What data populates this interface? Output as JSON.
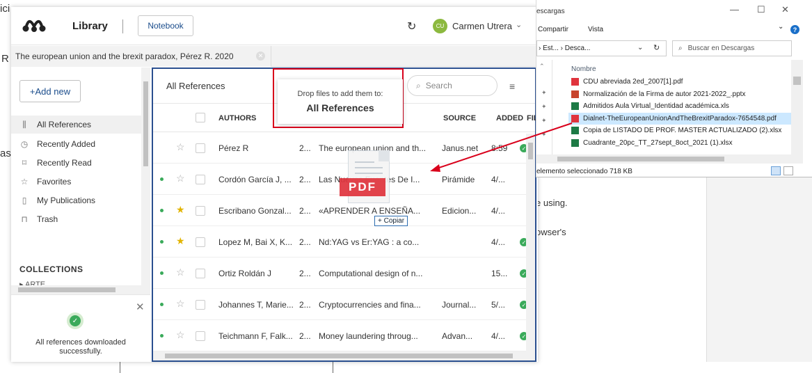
{
  "background": {
    "edge_text_top": "ici",
    "edge_text_r": "R",
    "edge_text_as": "as",
    "frag_using": "e using.",
    "frag_browser": "owser's"
  },
  "mendeley": {
    "header": {
      "library_title": "Library",
      "notebook_label": "Notebook",
      "avatar_initials": "CU",
      "user_name": "Carmen Utrera"
    },
    "tab": {
      "label": "The european union and the brexit paradox, Pérez R. 2020"
    },
    "sidebar": {
      "add_new_label": "+Add new",
      "items": [
        {
          "label": "All References",
          "icon": "library-icon",
          "glyph": "⫼"
        },
        {
          "label": "Recently Added",
          "icon": "clock-icon",
          "glyph": "◷"
        },
        {
          "label": "Recently Read",
          "icon": "bookmark-icon",
          "glyph": "⌑"
        },
        {
          "label": "Favorites",
          "icon": "star-icon",
          "glyph": "☆"
        },
        {
          "label": "My Publications",
          "icon": "document-icon",
          "glyph": "▯"
        },
        {
          "label": "Trash",
          "icon": "trash-icon",
          "glyph": "🗑"
        }
      ],
      "collections_heading": "COLLECTIONS",
      "collection_first": "ARTE"
    },
    "toast": {
      "message": "All references downloaded successfully."
    },
    "main": {
      "title": "All References",
      "search_placeholder": "Search",
      "columns": {
        "authors": "AUTHORS",
        "source": "SOURCE",
        "added": "ADDED",
        "file": "FIL"
      },
      "rows": [
        {
          "unread": false,
          "favorite": false,
          "author": "Pérez R",
          "year": "2...",
          "title": "The european union and th...",
          "source": "Janus.net",
          "added": "8:59",
          "downloaded": true
        },
        {
          "unread": true,
          "favorite": false,
          "author": "Cordón García J, ...",
          "year": "2...",
          "title": "Las Nuevas Fuentes De I...",
          "source": "Pirámide",
          "added": "4/...",
          "downloaded": false
        },
        {
          "unread": true,
          "favorite": true,
          "author": "Escribano Gonzal...",
          "year": "2...",
          "title": "«APRENDER A ENSEÑA...",
          "source": "Edicion...",
          "added": "4/...",
          "downloaded": false
        },
        {
          "unread": true,
          "favorite": true,
          "author": "Lopez M, Bai X, K...",
          "year": "2...",
          "title": "Nd:YAG vs Er:YAG : a co...",
          "source": "",
          "added": "4/...",
          "downloaded": true
        },
        {
          "unread": true,
          "favorite": false,
          "author": "Ortiz Roldán J",
          "year": "2...",
          "title": "Computational design of n...",
          "source": "",
          "added": "15...",
          "downloaded": true
        },
        {
          "unread": true,
          "favorite": false,
          "author": "Johannes T, Marie...",
          "year": "2...",
          "title": "Cryptocurrencies and fina...",
          "source": "Journal...",
          "added": "5/...",
          "downloaded": true
        },
        {
          "unread": true,
          "favorite": false,
          "author": "Teichmann F, Falk...",
          "year": "2...",
          "title": "Money laundering throug...",
          "source": "Advan...",
          "added": "4/...",
          "downloaded": true
        }
      ]
    },
    "drop_overlay": {
      "subtitle": "Drop files to add them to:",
      "target": "All References"
    },
    "drag": {
      "file_type_label": "PDF",
      "copy_badge": "+ Copiar"
    }
  },
  "explorer": {
    "title": "escargas",
    "controls": {
      "minimize": "—",
      "maximize": "☐",
      "close": "✕"
    },
    "menu": {
      "share": "Compartir",
      "view": "Vista",
      "expand": "⌄",
      "help": "?"
    },
    "path": "› Est... › Desca...",
    "search_placeholder": "Buscar en Descargas",
    "column_name": "Nombre",
    "files": [
      {
        "name": "CDU abreviada 2ed_2007[1].pdf",
        "type": "pdf",
        "selected": false
      },
      {
        "name": "Normalización de la Firma de autor 2021-2022_.pptx",
        "type": "pptx",
        "selected": false
      },
      {
        "name": "Admitidos Aula Virtual_Identidad académica.xls",
        "type": "xls",
        "selected": false
      },
      {
        "name": "Dialnet-TheEuropeanUnionAndTheBrexitParadox-7654548.pdf",
        "type": "pdf",
        "selected": true
      },
      {
        "name": "Copia de LISTADO DE PROF. MASTER ACTUALIZADO (2).xlsx",
        "type": "xlsx",
        "selected": false
      },
      {
        "name": "Cuadrante_20pc_TT_27sept_8oct_2021 (1).xlsx",
        "type": "xlsx",
        "selected": false
      }
    ],
    "status": "elemento seleccionado  718 KB"
  },
  "colors": {
    "accent_blue": "#2a4f8f",
    "mendeley_link": "#1a4c8b",
    "drop_highlight": "#d9001b",
    "success_green": "#3aaa5a",
    "favorite_gold": "#e2b400",
    "pdf_red": "#e0343d",
    "excel_green": "#1d7a45",
    "ppt_orange": "#c8442c",
    "selection_blue": "#cce8ff"
  }
}
